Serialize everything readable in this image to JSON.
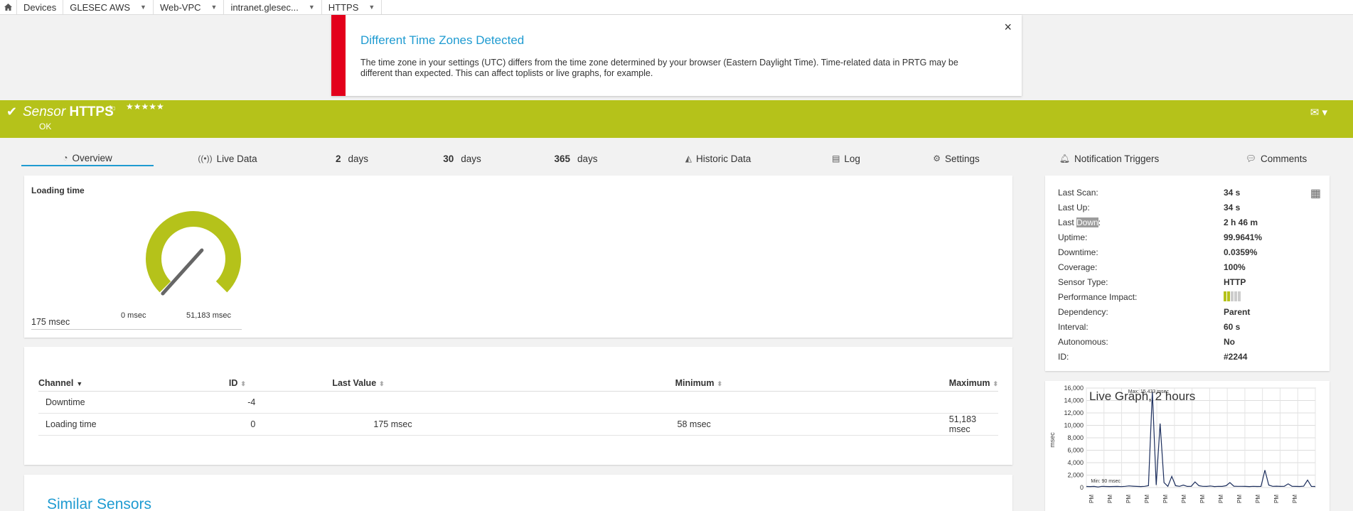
{
  "breadcrumb": [
    {
      "label": "Devices",
      "caret": false
    },
    {
      "label": "GLESEC AWS",
      "caret": true
    },
    {
      "label": "Web-VPC",
      "caret": true
    },
    {
      "label": "intranet.glesec...",
      "caret": true
    },
    {
      "label": "HTTPS",
      "caret": true
    }
  ],
  "timezone_banner": {
    "title": "Different Time Zones Detected",
    "message": "The time zone in your settings (UTC) differs from the time zone determined by your browser (Eastern Daylight Time). Time-related data in PRTG may be different than expected. This can affect toplists or live graphs, for example.",
    "close": "×",
    "accent_color": "#e3001b"
  },
  "sensor": {
    "prefix": "Sensor",
    "name": "HTTPS",
    "stars": "★★★★★",
    "status": "OK",
    "status_color": "#b5c21a"
  },
  "tabs": {
    "overview": "Overview",
    "live_data": "Live Data",
    "d2_num": "2",
    "d2_unit": "days",
    "d30_num": "30",
    "d30_unit": "days",
    "d365_num": "365",
    "d365_unit": "days",
    "historic": "Historic Data",
    "log": "Log",
    "settings": "Settings",
    "triggers": "Notification Triggers",
    "comments": "Comments"
  },
  "gauge": {
    "label": "Loading time",
    "value": "175 msec",
    "min": "0 msec",
    "max": "51,183 msec",
    "fraction": 0.0034,
    "color": "#b5c21a"
  },
  "channels": {
    "headers": {
      "channel": "Channel",
      "id": "ID",
      "last": "Last Value",
      "min": "Minimum",
      "max": "Maximum"
    },
    "rows": [
      {
        "channel": "Downtime",
        "id": "-4",
        "last": "",
        "min": "",
        "max": ""
      },
      {
        "channel": "Loading time",
        "id": "0",
        "last": "175 msec",
        "min": "58 msec",
        "max": "51,183 msec"
      }
    ]
  },
  "similar": {
    "title": "Similar Sensors"
  },
  "info": {
    "last_scan_label": "Last Scan:",
    "last_scan": "34 s",
    "last_up_label": "Last Up:",
    "last_up": "34 s",
    "last_down_prefix": "Last ",
    "last_down_hl": "Down",
    "last_down_suffix": ":",
    "last_down": "2 h 46 m",
    "uptime_label": "Uptime:",
    "uptime": "99.9641%",
    "downtime_label": "Downtime:",
    "downtime": "0.0359%",
    "coverage_label": "Coverage:",
    "coverage": "100%",
    "sensor_type_label": "Sensor Type:",
    "sensor_type": "HTTP",
    "perf_label": "Performance Impact:",
    "perf_level": 2,
    "perf_total": 5,
    "dependency_label": "Dependency:",
    "dependency": "Parent",
    "interval_label": "Interval:",
    "interval": "60 s",
    "autonomous_label": "Autonomous:",
    "autonomous": "No",
    "id_label": "ID:",
    "id": "#2244"
  },
  "chart_data": {
    "type": "line",
    "title": "Live Graph, 2 hours",
    "ylabel": "msec",
    "ylim": [
      0,
      16000
    ],
    "yticks": [
      "0",
      "2,000",
      "4,000",
      "6,000",
      "8,000",
      "10,000",
      "12,000",
      "14,000",
      "16,000"
    ],
    "xtick_label": "PM",
    "annotations": {
      "max": "Max: 15,433 msec",
      "min": "Min: 90 msec"
    },
    "grid": true,
    "series": [
      {
        "color": "#1b2d5c",
        "values": [
          170,
          160,
          180,
          90,
          200,
          175,
          160,
          170,
          180,
          150,
          200,
          260,
          220,
          180,
          160,
          190,
          300,
          15433,
          400,
          10300,
          800,
          200,
          1800,
          300,
          200,
          400,
          180,
          200,
          900,
          300,
          200,
          180,
          250,
          160,
          200,
          180,
          300,
          800,
          220,
          190,
          200,
          180,
          160,
          200,
          170,
          180,
          2800,
          400,
          200,
          220,
          180,
          190,
          600,
          200,
          180,
          170,
          220,
          1200,
          180,
          175
        ]
      }
    ]
  }
}
